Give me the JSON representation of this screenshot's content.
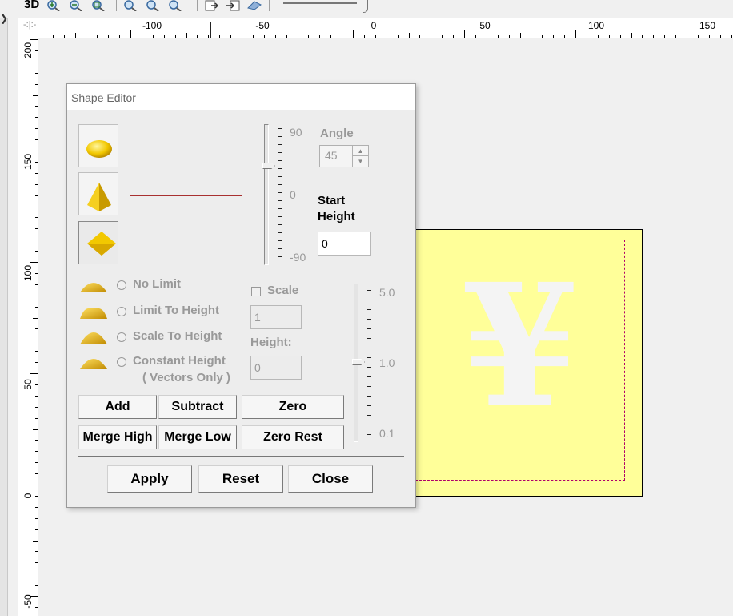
{
  "toolbar": {
    "label_3d": "3D",
    "buttons": [
      "zoom-in-icon",
      "zoom-out-icon",
      "zoom-fit-icon",
      "zoom-window-icon",
      "zoom-previous-icon",
      "zoom-all-icon",
      "export-icon",
      "import-icon",
      "render-icon"
    ]
  },
  "ruler": {
    "top_labels": [
      "-100",
      "-50",
      "0",
      "50",
      "100",
      "150"
    ],
    "left_labels": [
      "200",
      "150",
      "100",
      "50",
      "0",
      "-50"
    ]
  },
  "canvas": {
    "symbol": "¥",
    "plate_color": "#ffff99",
    "outline_color": "#b0006a"
  },
  "dialog": {
    "title": "Shape Editor",
    "shapes": [
      "round-shape-icon",
      "pyramid-shape-icon",
      "flat-diamond-shape-icon"
    ],
    "angle_slider": {
      "max_label": "90",
      "mid_label": "0",
      "min_label": "-90"
    },
    "angle": {
      "label": "Angle",
      "value": "45"
    },
    "start_height": {
      "label_line1": "Start",
      "label_line2": "Height",
      "value": "0"
    },
    "combine_modes": [
      {
        "label": "No Limit"
      },
      {
        "label": "Limit To Height"
      },
      {
        "label": "Scale To Height"
      },
      {
        "label": "Constant Height",
        "sublabel": "( Vectors Only )"
      }
    ],
    "scale": {
      "label": "Scale",
      "value": "1"
    },
    "height": {
      "label": "Height:",
      "value": "0"
    },
    "scale_slider": {
      "max_label": "5.0",
      "mid_label": "1.0",
      "min_label": "0.1"
    },
    "buttons": {
      "add": "Add",
      "subtract": "Subtract",
      "zero": "Zero",
      "merge_high": "Merge High",
      "merge_low": "Merge Low",
      "zero_rest": "Zero Rest",
      "apply": "Apply",
      "reset": "Reset",
      "close": "Close"
    }
  }
}
